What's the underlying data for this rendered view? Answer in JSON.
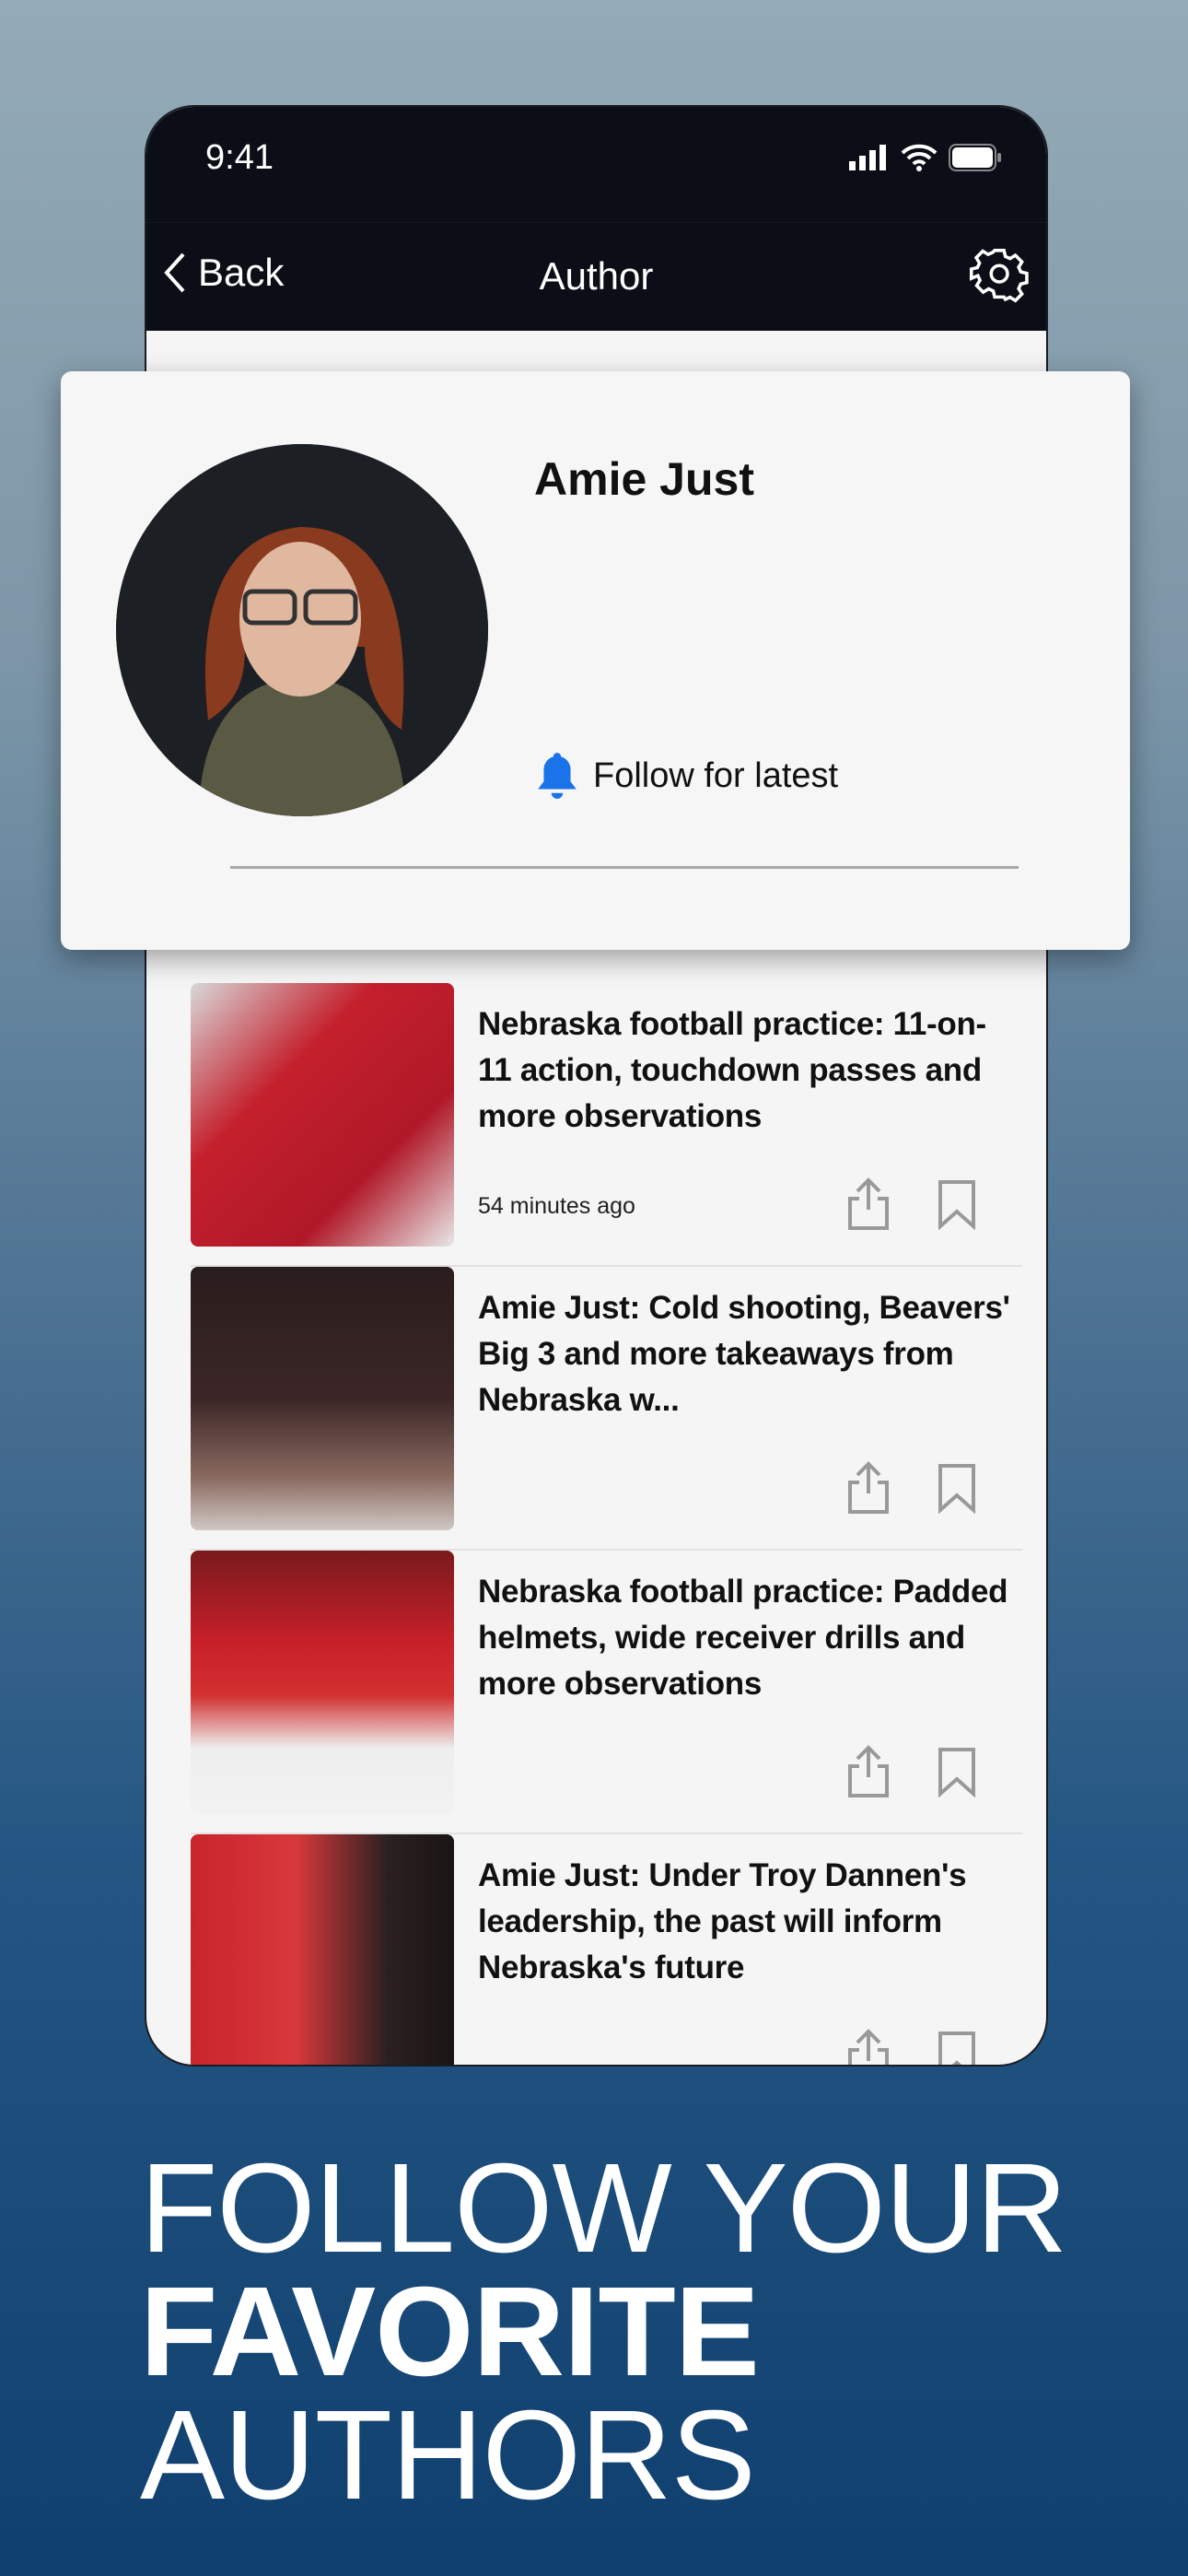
{
  "status_bar": {
    "time": "9:41"
  },
  "nav": {
    "back_label": "Back",
    "title": "Author"
  },
  "author": {
    "name": "Amie Just",
    "follow_label": "Follow for latest"
  },
  "colors": {
    "bell": "#1a73e8",
    "nav_bg": "#0b0e16"
  },
  "articles": [
    {
      "title": "Nebraska football practice: 11-on-11 action, touchdown passes and more observations",
      "time": "54 minutes ago"
    },
    {
      "title": "Amie Just: Cold shooting, Beavers' Big 3 and more takeaways from Nebraska w...",
      "time": ""
    },
    {
      "title": "Nebraska football practice: Padded helmets, wide receiver drills and more observations",
      "time": ""
    },
    {
      "title": "Amie Just: Under Troy Dannen's leadership, the past will inform Nebraska's future",
      "time": ""
    }
  ],
  "tagline": {
    "line1": "FOLLOW YOUR",
    "line2": "FAVORITE",
    "line3": "AUTHORS"
  }
}
